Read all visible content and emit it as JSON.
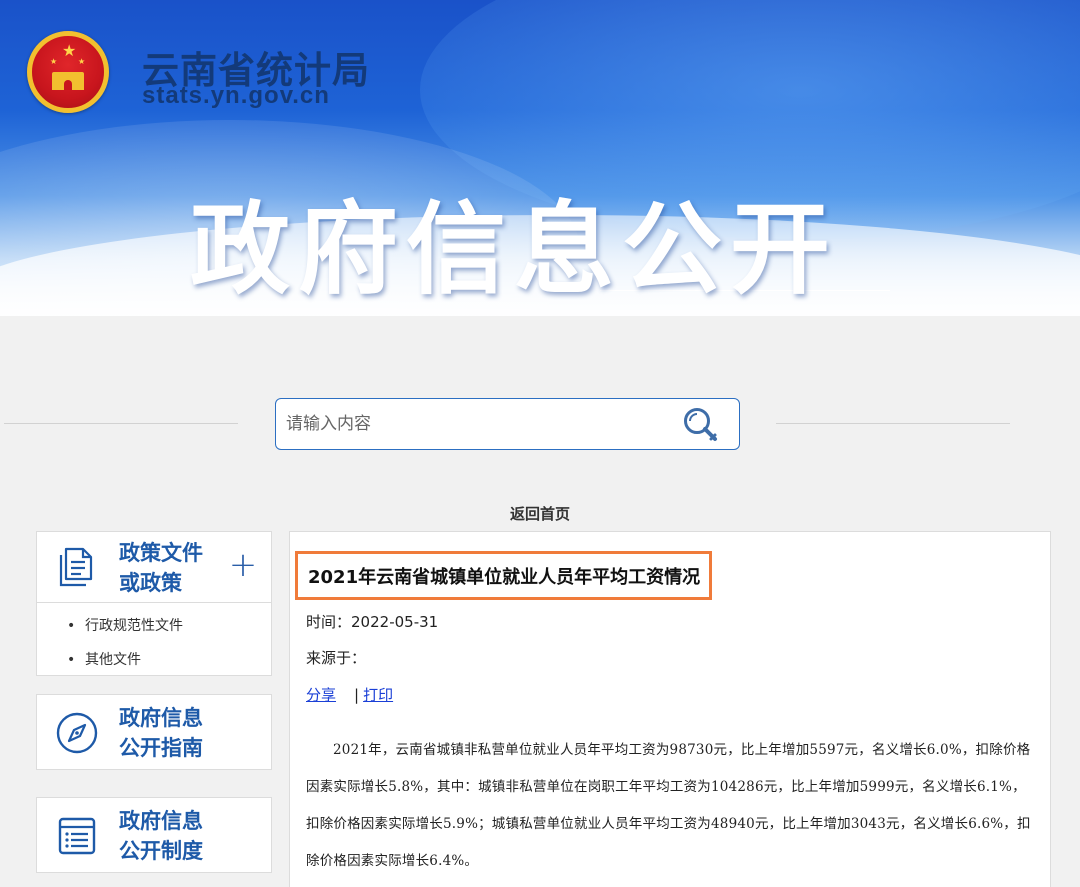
{
  "header": {
    "site_name": "云南省统计局",
    "site_domain": "stats.yn.gov.cn",
    "hero_title": "政府信息公开"
  },
  "search": {
    "placeholder": "请输入内容",
    "icon": "search-icon"
  },
  "nav": {
    "back_home": "返回首页"
  },
  "sidebar": {
    "cards": [
      {
        "title": "政策文件或政策",
        "title_line1": "政策文件",
        "title_line2": "或政策",
        "icon": "document-icon",
        "expand_symbol": "+",
        "items": [
          {
            "label": "行政规范性文件"
          },
          {
            "label": "其他文件"
          }
        ]
      },
      {
        "title_line1": "政府信息",
        "title_line2": "公开指南",
        "icon": "compass-icon"
      },
      {
        "title_line1": "政府信息",
        "title_line2": "公开制度",
        "icon": "list-icon"
      }
    ]
  },
  "article": {
    "title": "2021年云南省城镇单位就业人员年平均工资情况",
    "time_label": "时间：",
    "time_value": "2022-05-31",
    "source_label": "来源于：",
    "share_label": "分享",
    "separator": "|",
    "print_label": "打印",
    "body": "2021年，云南省城镇非私营单位就业人员年平均工资为98730元，比上年增加5597元，名义增长6.0%，扣除价格因素实际增长5.8%，其中：城镇非私营单位在岗职工年平均工资为104286元，比上年增加5999元，名义增长6.1%，扣除价格因素实际增长5.9%；城镇私营单位就业人员年平均工资为48940元，比上年增加3043元，名义增长6.6%，扣除价格因素实际增长6.4%。"
  },
  "colors": {
    "brand_blue": "#1e5aa8",
    "highlight_border": "#f07b3a",
    "link_blue": "#1a3fd6"
  }
}
